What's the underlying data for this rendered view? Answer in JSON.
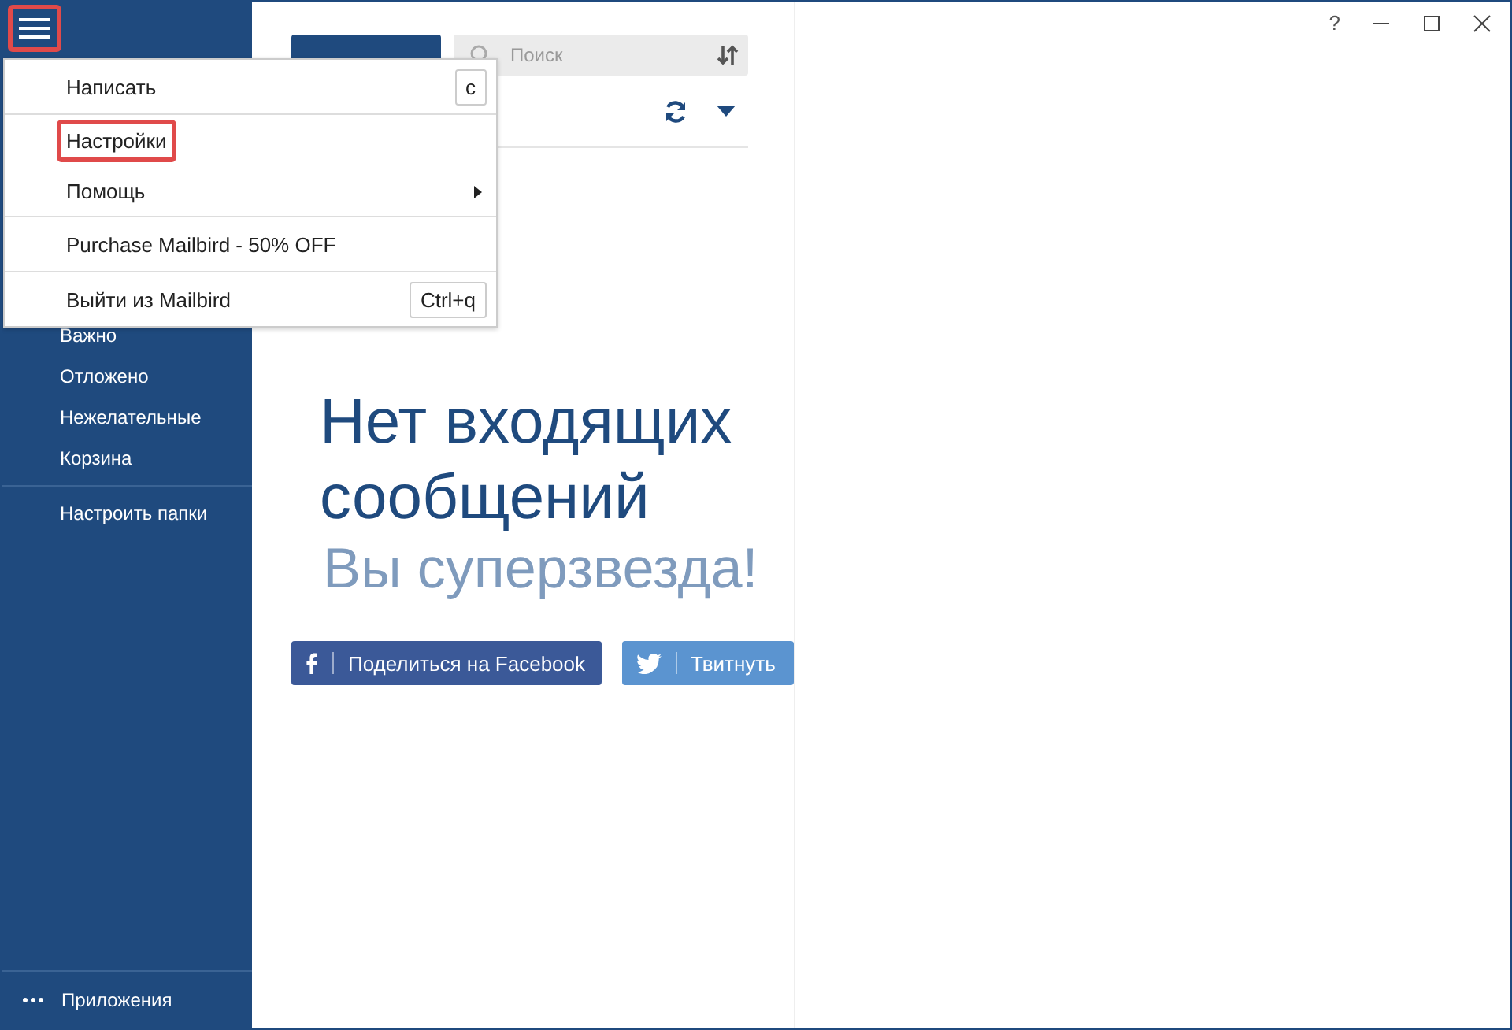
{
  "window": {
    "help": "?"
  },
  "sidebar": {
    "folders": [
      {
        "label": "Важно"
      },
      {
        "label": "Отложено"
      },
      {
        "label": "Нежелательные"
      },
      {
        "label": "Корзина"
      }
    ],
    "manage": "Настроить папки",
    "apps": "Приложения"
  },
  "toolbar": {
    "search": {
      "placeholder": "Поиск"
    }
  },
  "empty": {
    "title": "Нет входящих сообщений",
    "subtitle": "Вы суперзвезда!",
    "buttons": [
      {
        "kind": "facebook",
        "label": "Поделиться на Facebook"
      },
      {
        "kind": "twitter",
        "label": "Твитнуть"
      }
    ]
  },
  "menu": {
    "groups": [
      [
        {
          "label": "Написать",
          "shortcut": "c",
          "highlighted": false,
          "submenu": false
        }
      ],
      [
        {
          "label": "Настройки",
          "highlighted": true,
          "submenu": false
        },
        {
          "label": "Помощь",
          "highlighted": false,
          "submenu": true
        }
      ],
      [
        {
          "label": "Purchase Mailbird - 50% OFF",
          "highlighted": false,
          "submenu": false
        }
      ],
      [
        {
          "label": "Выйти из Mailbird",
          "shortcut": "Ctrl+q",
          "highlighted": false,
          "submenu": false
        }
      ]
    ]
  }
}
